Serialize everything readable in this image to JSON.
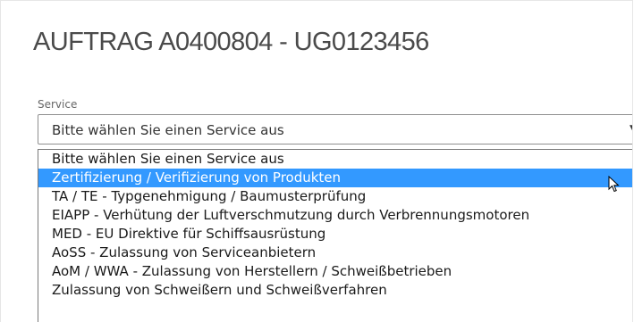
{
  "header": {
    "title": "AUFTRAG A0400804 - UG0123456"
  },
  "service_field": {
    "label": "Service",
    "selected_value": "Bitte wählen Sie einen Service aus",
    "arrow_icon": "triangle-down-icon",
    "highlighted_index": 1,
    "options": [
      "Bitte wählen Sie einen Service aus",
      "Zertifizierung / Verifizierung von Produkten",
      "TA / TE - Typgenehmigung / Baumusterprüfung",
      "EIAPP - Verhütung der Luftverschmutzung durch Verbrennungsmotoren",
      "MED - EU Direktive für Schiffsausrüstung",
      "AoSS - Zulassung von Serviceanbietern",
      "AoM / WWA - Zulassung von Herstellern / Schweißbetrieben",
      "Zulassung von Schweißern und Schweißverfahren"
    ]
  },
  "colors": {
    "highlight": "#3399ff",
    "title_text": "#4a4a4a",
    "label_text": "#666666"
  },
  "cursor_icon": "mouse-pointer-icon"
}
